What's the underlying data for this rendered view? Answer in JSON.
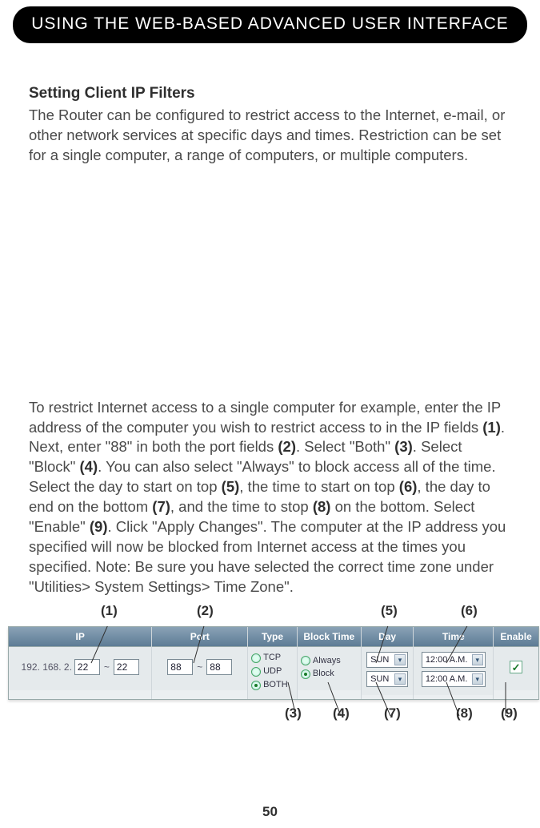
{
  "header": {
    "title": "USING THE WEB-BASED ADVANCED USER INTERFACE"
  },
  "section": {
    "subtitle": "Setting Client IP Filters",
    "intro": "The Router can be configured to restrict access to the Internet, e-mail, or other network services at specific days and times. Restriction can be set for a single computer, a range of computers, or multiple computers.",
    "detail_parts": [
      "To restrict Internet access to a single computer for example, enter the IP address of the computer you wish to restrict access to in the IP fields ",
      "(1)",
      ". Next, enter \"88\" in both the port fields ",
      "(2)",
      ". Select \"Both\" ",
      "(3)",
      ". Select \"Block\" ",
      "(4)",
      ". You can also select \"Always\" to block access all of the time. Select the day to start on top ",
      "(5)",
      ", the time to start on top ",
      "(6)",
      ", the day to end on the bottom ",
      "(7)",
      ", and the time to stop ",
      "(8)",
      " on the bottom. Select \"Enable\" ",
      "(9)",
      ". Click \"Apply Changes\". The computer at the IP address you specified will now be blocked from Internet access at the times you specified. Note: Be sure you have selected the correct time zone under \"Utilities> System Settings> Time Zone\"."
    ]
  },
  "callouts_top": {
    "c1": "(1)",
    "c2": "(2)",
    "c5": "(5)",
    "c6": "(6)"
  },
  "callouts_bottom": {
    "c3": "(3)",
    "c4": "(4)",
    "c7": "(7)",
    "c8": "(8)",
    "c9": "(9)"
  },
  "table": {
    "headers": {
      "ip": "IP",
      "port": "Port",
      "type": "Type",
      "block_time": "Block Time",
      "day": "Day",
      "time": "Time",
      "enable": "Enable"
    },
    "ip_prefix": "192. 168. 2.",
    "ip_a": "22",
    "ip_b": "22",
    "port_a": "88",
    "port_b": "88",
    "type_opts": {
      "tcp": "TCP",
      "udp": "UDP",
      "both": "BOTH"
    },
    "bt_opts": {
      "always": "Always",
      "block": "Block"
    },
    "day_top": "SUN",
    "day_bot": "SUN",
    "time_top": "12:00 A.M.",
    "time_bot": "12:00 A.M.",
    "enable_checked": true
  },
  "page_number": "50"
}
